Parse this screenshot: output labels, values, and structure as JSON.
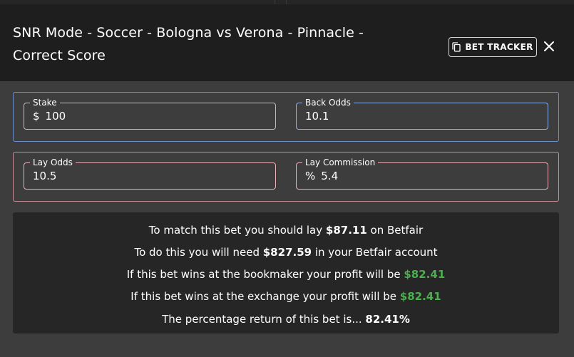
{
  "modal": {
    "title": "SNR Mode - Soccer - Bologna vs Verona - Pinnacle - Correct Score",
    "bet_tracker_label": "BET TRACKER",
    "icons": {
      "bet_tracker": "copy-icon",
      "close": "close-icon"
    }
  },
  "inputs": {
    "stake": {
      "label": "Stake",
      "adornment": "$",
      "value": "100"
    },
    "back_odds": {
      "label": "Back Odds",
      "value": "10.1"
    },
    "lay_odds": {
      "label": "Lay Odds",
      "value": "10.5"
    },
    "lay_commission": {
      "label": "Lay Commission",
      "adornment": "%",
      "value": "5.4"
    }
  },
  "results": {
    "line1": {
      "prefix": "To match this bet you should lay ",
      "amount": "$87.11",
      "suffix": " on Betfair"
    },
    "line2": {
      "prefix": "To do this you will need ",
      "amount": "$827.59",
      "suffix": " in your Betfair account"
    },
    "line3": {
      "prefix": "If this bet wins at the bookmaker your profit will be ",
      "amount": "$82.41"
    },
    "line4": {
      "prefix": "If this bet wins at the exchange your profit will be ",
      "amount": "$82.41"
    },
    "line5": {
      "prefix": "The percentage return of this bet is... ",
      "amount": "82.41%"
    }
  },
  "colors": {
    "accent_blue": "#6c8fc9",
    "accent_pink": "#c89098",
    "profit_green": "#4caf50"
  }
}
